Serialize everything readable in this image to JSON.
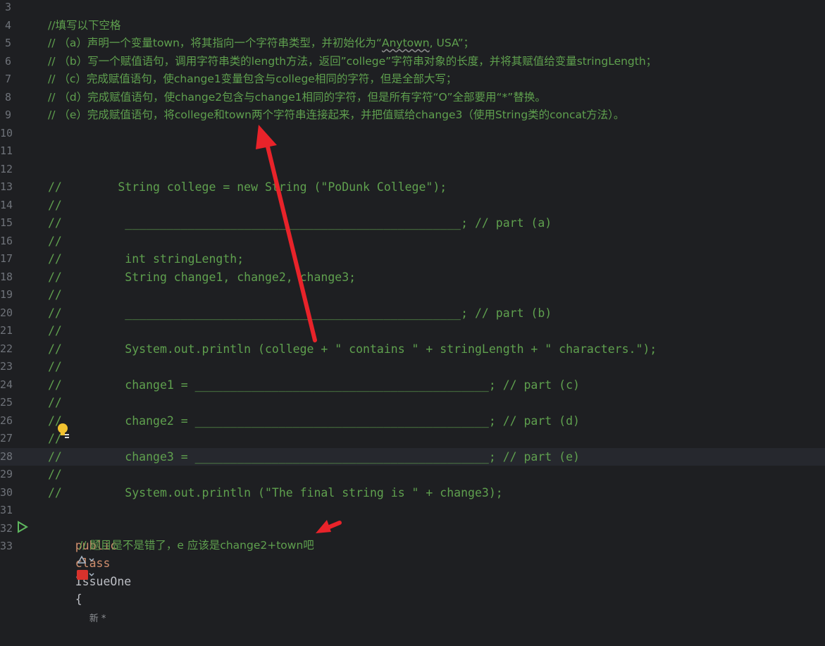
{
  "editor": {
    "lines": [
      {
        "n": "3",
        "text": ""
      },
      {
        "n": "4",
        "text": "//填写以下空格"
      },
      {
        "n": "5",
        "parts": [
          {
            "t": "// （a）声明一个变量town，将其指向一个字符串类型，并初始化为“"
          },
          {
            "t": "Anytown",
            "squiggle": true
          },
          {
            "t": ", USA”；"
          }
        ]
      },
      {
        "n": "6",
        "text": "// （b）写一个赋值语句，调用字符串类的length方法，返回”college”字符串对象的长度，并将其赋值给变量stringLength；"
      },
      {
        "n": "7",
        "text": "// （c）完成赋值语句，使change1变量包含与college相同的字符，但是全部大写；"
      },
      {
        "n": "8",
        "text": "// （d）完成赋值语句，使change2包含与change1相同的字符，但是所有字符“O”全部要用“*”替换。"
      },
      {
        "n": "9",
        "text": "// （e）完成赋值语句，将college和town两个字符串连接起来，并把值赋给change3（使用String类的concat方法）。"
      },
      {
        "n": "10",
        "text": ""
      },
      {
        "n": "11",
        "text": ""
      },
      {
        "n": "12",
        "text": ""
      },
      {
        "n": "13",
        "text": "//        String college = new String (\"PoDunk College\");"
      },
      {
        "n": "14",
        "text": "//"
      },
      {
        "n": "15",
        "text": "//         ________________________________________________; // part (a)"
      },
      {
        "n": "16",
        "text": "//"
      },
      {
        "n": "17",
        "text": "//         int stringLength;"
      },
      {
        "n": "18",
        "text": "//         String change1, change2, change3;"
      },
      {
        "n": "19",
        "text": "//"
      },
      {
        "n": "20",
        "text": "//         ________________________________________________; // part (b)"
      },
      {
        "n": "21",
        "text": "//"
      },
      {
        "n": "22",
        "text": "//         System.out.println (college + \" contains \" + stringLength + \" characters.\");"
      },
      {
        "n": "23",
        "text": "//"
      },
      {
        "n": "24",
        "text": "//         change1 = __________________________________________; // part (c)"
      },
      {
        "n": "25",
        "text": "//"
      },
      {
        "n": "26",
        "text": "//         change2 = __________________________________________; // part (d)"
      },
      {
        "n": "27",
        "text": "//"
      },
      {
        "n": "28",
        "text": "//         change3 = __________________________________________; // part (e)"
      },
      {
        "n": "29",
        "text": "//"
      },
      {
        "n": "30",
        "text": "//         System.out.println (\"The final string is \" + change3);"
      },
      {
        "n": "31",
        "text": ""
      },
      {
        "n": "32",
        "text": ""
      },
      {
        "n": "33",
        "text": ""
      }
    ],
    "class_decl": {
      "kw1": "public",
      "kw2": "class",
      "name": "IssueOne",
      "brace": "{",
      "hint": "新 *"
    },
    "note": "// 题目是不是错了，e 应该是change2+town吧",
    "active_line": "28"
  },
  "colors": {
    "background": "#1e1f22",
    "comment": "#5fa04e",
    "keyword": "#cf8e6d",
    "arrow": "#e8232a"
  }
}
